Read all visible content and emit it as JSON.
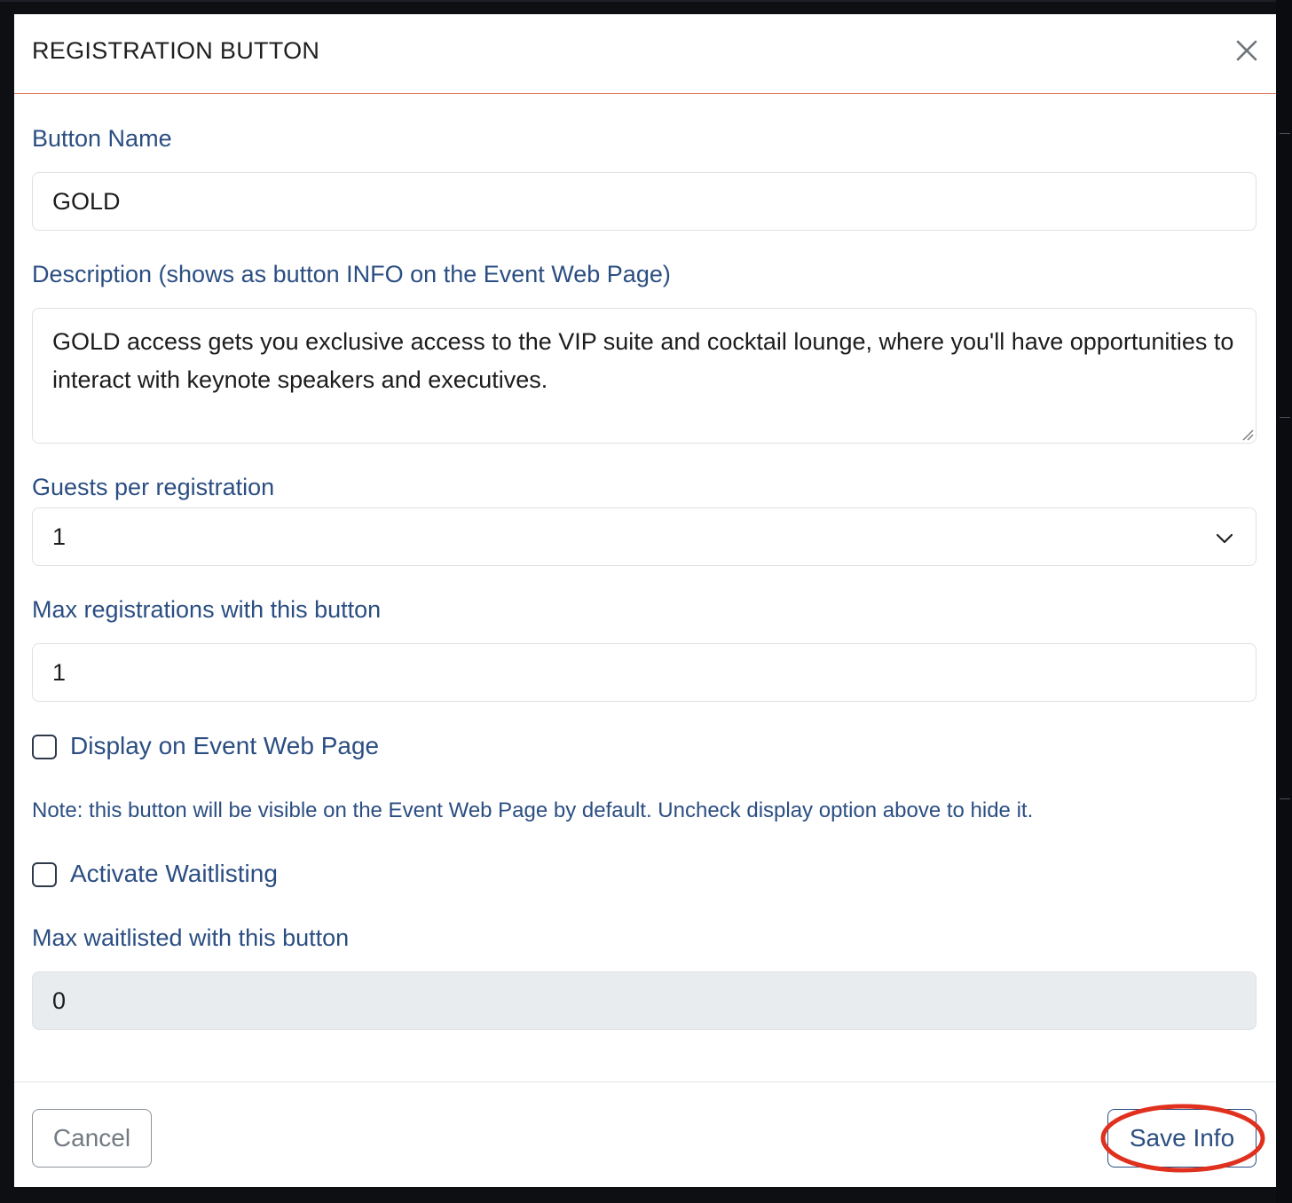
{
  "modal": {
    "title": "REGISTRATION BUTTON"
  },
  "form": {
    "button_name": {
      "label": "Button Name",
      "value": "GOLD"
    },
    "description": {
      "label": "Description (shows as button INFO on the Event Web Page)",
      "value": "GOLD access gets you exclusive access to the VIP suite and cocktail lounge, where you'll have opportunities to interact with keynote speakers and executives."
    },
    "guests_per_registration": {
      "label": "Guests per registration",
      "selected": "1"
    },
    "max_registrations": {
      "label": "Max registrations with this button",
      "value": "1"
    },
    "display_on_web_page": {
      "label": "Display on Event Web Page",
      "checked": false
    },
    "note": "Note: this button will be visible on the Event Web Page by default. Uncheck display option above to hide it.",
    "activate_waitlisting": {
      "label": "Activate Waitlisting",
      "checked": false
    },
    "max_waitlisted": {
      "label": "Max waitlisted with this button",
      "value": "0",
      "disabled": true
    }
  },
  "footer": {
    "cancel_label": "Cancel",
    "save_label": "Save Info"
  },
  "icons": {
    "close": "close-icon",
    "select_arrow": "chevron-down-icon",
    "resize": "resize-grip-icon"
  },
  "colors": {
    "label": "#2b4e82",
    "header_divider": "#e07056",
    "annotation": "#e0301e",
    "disabled_field": "#e9ecef"
  }
}
